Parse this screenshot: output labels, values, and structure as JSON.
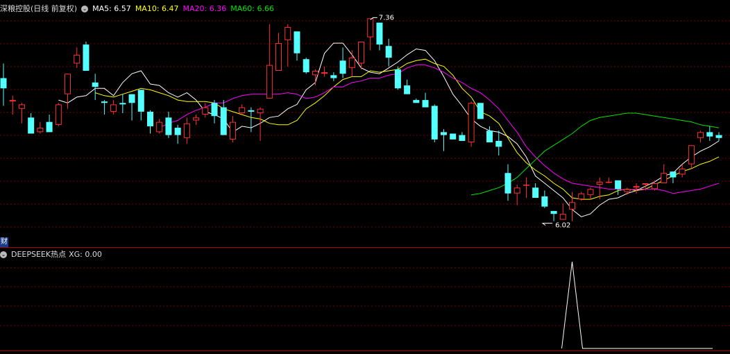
{
  "header": {
    "title": "深粮控股(日线 前复权)",
    "ma5": "MA5: 6.57",
    "ma10": "MA10: 6.47",
    "ma20": "MA20: 6.36",
    "ma60": "MA60: 6.66"
  },
  "indicator": {
    "title": "DEEPSEEK热点",
    "xg": "XG: 0.00"
  },
  "badge": "财",
  "annotations": {
    "high": "7.36",
    "low": "6.02"
  },
  "colors": {
    "up": "#ff3232",
    "down": "#54ffff",
    "ma5": "#ffffff",
    "ma10": "#ffff00",
    "ma20": "#ff00ff",
    "ma60": "#00e600",
    "grid": "#7a0000",
    "separator": "#b00000"
  },
  "chart_data": {
    "type": "candlestick",
    "ylim": [
      5.88,
      7.43
    ],
    "candles": [
      [
        6.99,
        6.92,
        7.09,
        6.8
      ],
      [
        6.83,
        6.84,
        6.87,
        6.74
      ],
      [
        6.78,
        6.81,
        6.82,
        6.68
      ],
      [
        6.72,
        6.61,
        6.75,
        6.61
      ],
      [
        6.62,
        6.65,
        6.69,
        6.61
      ],
      [
        6.69,
        6.62,
        6.74,
        6.62
      ],
      [
        6.67,
        6.81,
        6.82,
        6.66
      ],
      [
        6.88,
        7.02,
        7.02,
        6.78
      ],
      [
        7.09,
        7.15,
        7.2,
        7.06
      ],
      [
        7.22,
        7.04,
        7.24,
        7.04
      ],
      [
        6.96,
        6.93,
        7.02,
        6.84
      ],
      [
        6.83,
        6.82,
        6.84,
        6.74
      ],
      [
        6.76,
        6.81,
        6.84,
        6.74
      ],
      [
        6.82,
        6.81,
        6.88,
        6.75
      ],
      [
        6.88,
        6.82,
        6.88,
        6.7
      ],
      [
        6.91,
        6.76,
        6.91,
        6.7
      ],
      [
        6.76,
        6.66,
        6.77,
        6.61
      ],
      [
        6.62,
        6.69,
        6.71,
        6.61
      ],
      [
        6.72,
        6.6,
        6.76,
        6.58
      ],
      [
        6.65,
        6.6,
        6.67,
        6.54
      ],
      [
        6.58,
        6.68,
        6.72,
        6.54
      ],
      [
        6.7,
        6.72,
        6.74,
        6.67
      ],
      [
        6.74,
        6.79,
        6.82,
        6.72
      ],
      [
        6.82,
        6.73,
        6.84,
        6.68
      ],
      [
        6.79,
        6.6,
        6.84,
        6.6
      ],
      [
        6.57,
        6.69,
        6.73,
        6.55
      ],
      [
        6.75,
        6.79,
        6.81,
        6.74
      ],
      [
        6.77,
        6.76,
        6.79,
        6.62
      ],
      [
        6.75,
        6.78,
        6.79,
        6.56
      ],
      [
        6.85,
        7.08,
        7.36,
        6.87
      ],
      [
        7.04,
        7.23,
        7.3,
        7.06
      ],
      [
        7.25,
        7.34,
        7.36,
        7.07
      ],
      [
        7.31,
        7.16,
        7.3,
        7.11
      ],
      [
        7.12,
        7.03,
        7.13,
        7.02
      ],
      [
        7.01,
        7.04,
        7.05,
        6.94
      ],
      [
        7.02,
        7.03,
        7.07,
        7.0
      ],
      [
        7.01,
        6.99,
        7.03,
        6.97
      ],
      [
        7.11,
        7.02,
        7.2,
        6.99
      ],
      [
        7.06,
        7.13,
        7.18,
        7.0
      ],
      [
        7.09,
        7.24,
        7.23,
        7.05
      ],
      [
        7.27,
        7.4,
        7.39,
        7.18
      ],
      [
        7.37,
        7.22,
        7.37,
        7.18
      ],
      [
        7.21,
        7.13,
        7.26,
        7.07
      ],
      [
        7.05,
        6.92,
        7.07,
        6.91
      ],
      [
        6.94,
        6.88,
        6.98,
        6.88
      ],
      [
        6.84,
        6.82,
        6.85,
        6.82
      ],
      [
        6.84,
        6.79,
        6.89,
        6.79
      ],
      [
        6.8,
        6.57,
        6.81,
        6.55
      ],
      [
        6.62,
        6.6,
        6.64,
        6.49
      ],
      [
        6.61,
        6.57,
        6.61,
        6.58
      ],
      [
        6.6,
        6.56,
        6.62,
        6.56
      ],
      [
        6.55,
        6.82,
        6.83,
        6.52
      ],
      [
        6.82,
        6.71,
        6.82,
        6.71
      ],
      [
        6.63,
        6.55,
        6.66,
        6.55
      ],
      [
        6.56,
        6.52,
        6.63,
        6.46
      ],
      [
        6.34,
        6.2,
        6.4,
        6.15
      ],
      [
        6.2,
        6.24,
        6.26,
        6.12
      ],
      [
        6.26,
        6.26,
        6.31,
        6.17
      ],
      [
        6.24,
        6.17,
        6.27,
        6.17
      ],
      [
        6.18,
        6.11,
        6.22,
        6.1
      ],
      [
        6.08,
        6.06,
        6.08,
        6.01
      ],
      [
        6.02,
        6.06,
        6.13,
        6.02
      ],
      [
        6.09,
        6.14,
        6.21,
        6.01
      ],
      [
        6.16,
        6.2,
        6.21,
        6.15
      ],
      [
        6.19,
        6.23,
        6.24,
        6.16
      ],
      [
        6.26,
        6.28,
        6.31,
        6.16
      ],
      [
        6.28,
        6.28,
        6.31,
        6.27
      ],
      [
        6.29,
        6.23,
        6.27,
        6.19
      ],
      [
        6.21,
        6.23,
        6.24,
        6.19
      ],
      [
        6.24,
        6.25,
        6.27,
        6.2
      ],
      [
        6.26,
        6.27,
        6.27,
        6.22
      ],
      [
        6.23,
        6.27,
        6.29,
        6.22
      ],
      [
        6.27,
        6.34,
        6.4,
        6.3
      ],
      [
        6.35,
        6.31,
        6.35,
        6.27
      ],
      [
        6.33,
        6.37,
        6.4,
        6.31
      ],
      [
        6.4,
        6.53,
        6.53,
        6.37
      ],
      [
        6.58,
        6.62,
        6.63,
        6.55
      ],
      [
        6.62,
        6.59,
        6.66,
        6.56
      ],
      [
        6.6,
        6.58,
        6.62,
        6.56
      ]
    ],
    "ma": {
      "ma5": [
        6.84,
        6.82,
        6.86,
        6.87,
        6.92,
        6.92,
        6.87,
        6.96,
        7.02,
        7.04,
        6.95,
        6.94,
        6.89,
        6.86,
        6.89,
        6.84,
        6.76,
        6.74,
        6.71,
        6.62,
        6.66,
        6.65,
        6.68,
        6.72,
        6.73,
        6.78,
        6.81,
        6.91,
        6.96,
        7.16,
        7.23,
        7.23,
        7.15,
        7.06,
        7.03,
        7.02,
        7.06,
        7.1,
        7.15,
        7.19,
        7.18,
        7.11,
        7.0,
        6.88,
        6.8,
        6.71,
        6.66,
        6.63,
        6.62,
        6.59,
        6.54,
        6.45,
        6.32,
        6.27,
        6.22,
        6.17,
        6.09,
        6.04,
        6.06,
        6.12,
        6.16,
        6.17,
        6.2,
        6.22,
        6.25,
        6.28,
        6.32,
        6.34,
        6.4,
        6.45,
        6.49,
        6.52,
        6.56
      ],
      "ma10": [
        6.89,
        6.87,
        6.86,
        6.88,
        6.9,
        6.92,
        6.91,
        6.89,
        6.87,
        6.84,
        6.83,
        6.83,
        6.83,
        6.82,
        6.78,
        6.76,
        6.74,
        6.72,
        6.71,
        6.68,
        6.67,
        6.67,
        6.7,
        6.78,
        6.82,
        6.87,
        6.93,
        6.98,
        7.0,
        7.0,
        7.04,
        7.03,
        7.04,
        7.05,
        7.09,
        7.11,
        7.12,
        7.09,
        7.07,
        7.01,
        6.92,
        6.86,
        6.76,
        6.73,
        6.68,
        6.58,
        6.48,
        6.41,
        6.36,
        6.32,
        6.27,
        6.23,
        6.17,
        6.16,
        6.16,
        6.18,
        6.19,
        6.22,
        6.23,
        6.22,
        6.23,
        6.26,
        6.29,
        6.32,
        6.35,
        6.37,
        6.4,
        6.42,
        6.45
      ],
      "ma20": [
        6.65,
        6.68,
        6.7,
        6.74,
        6.77,
        6.79,
        6.82,
        6.82,
        6.85,
        6.87,
        6.88,
        6.88,
        6.88,
        6.88,
        6.89,
        6.88,
        6.85,
        6.86,
        6.89,
        6.93,
        6.93,
        6.96,
        6.97,
        6.99,
        6.99,
        7.01,
        7.02,
        7.06,
        7.08,
        7.08,
        7.06,
        7.03,
        6.99,
        6.96,
        6.92,
        6.89,
        6.84,
        6.78,
        6.7,
        6.62,
        6.52,
        6.45,
        6.39,
        6.34,
        6.3,
        6.27,
        6.26,
        6.25,
        6.24,
        6.23,
        6.23,
        6.22,
        6.23,
        6.23,
        6.23,
        6.22,
        6.2,
        6.21,
        6.22,
        6.23,
        6.25,
        6.27
      ],
      "ma60": [
        6.19,
        6.2,
        6.22,
        6.24,
        6.27,
        6.31,
        6.37,
        6.43,
        6.49,
        6.53,
        6.57,
        6.61,
        6.66,
        6.7,
        6.72,
        6.73,
        6.74,
        6.75,
        6.75,
        6.74,
        6.73,
        6.72,
        6.71,
        6.7,
        6.69,
        6.67,
        6.66,
        6.65
      ]
    }
  }
}
